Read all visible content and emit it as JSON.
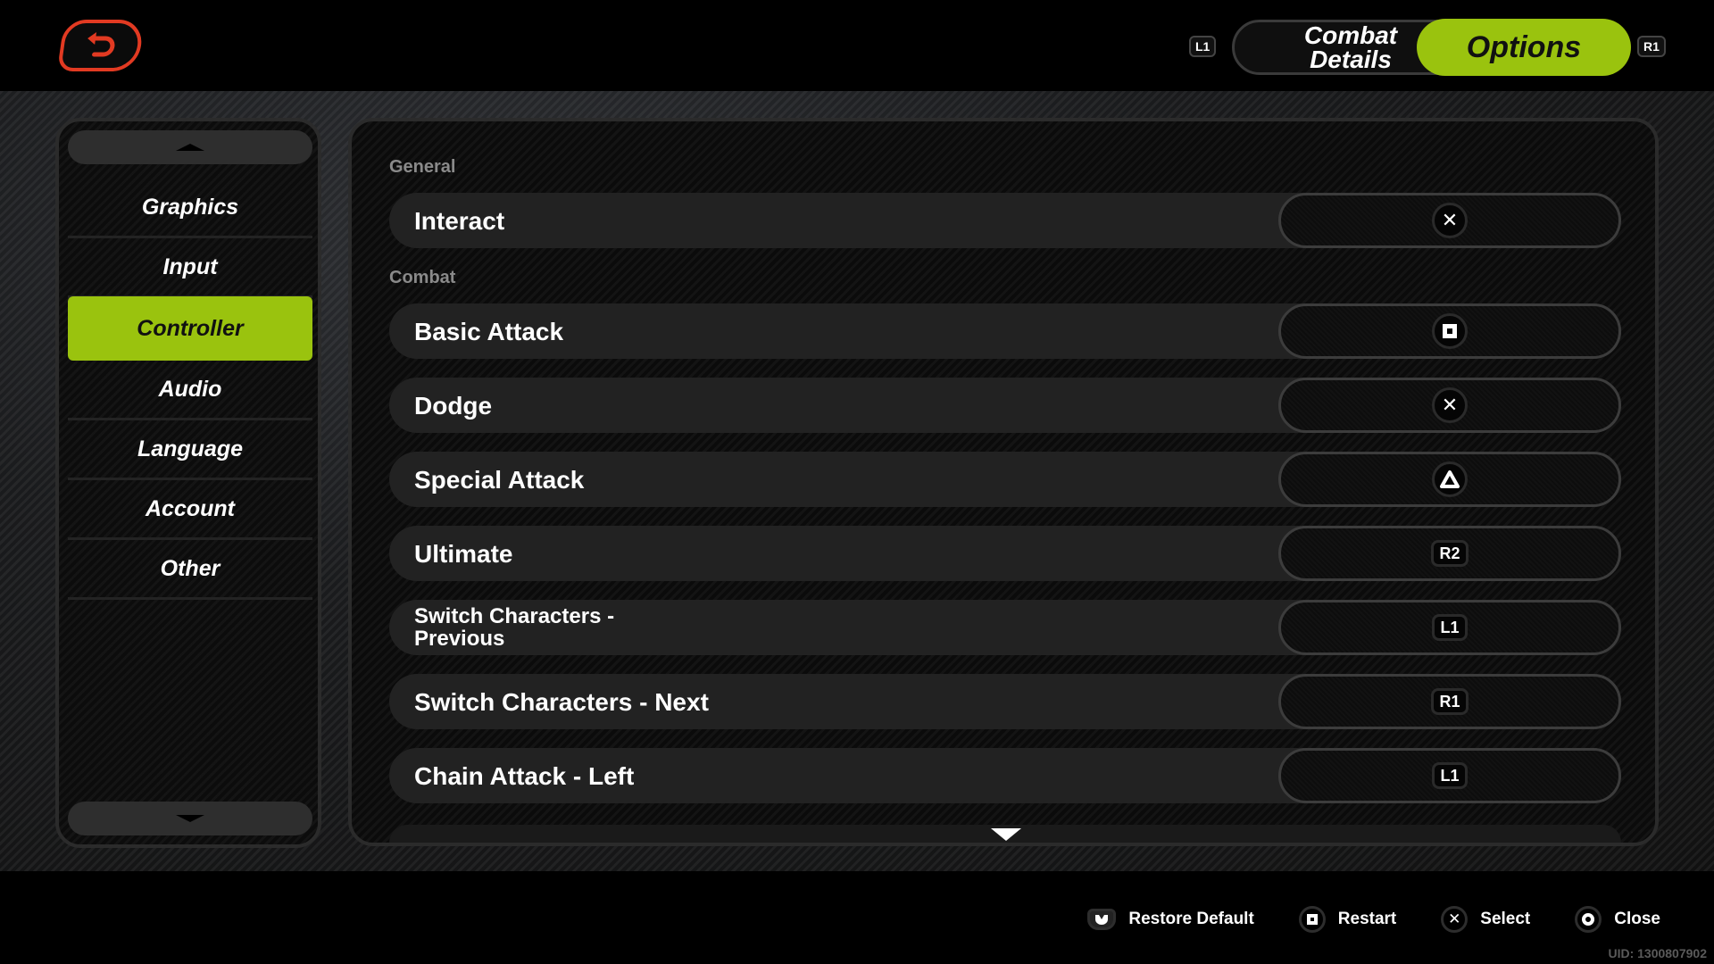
{
  "header": {
    "back_icon": "back-arrow-icon",
    "left_bumper": "L1",
    "right_bumper": "R1",
    "tabs": [
      {
        "label": "Combat\nDetails",
        "active": false
      },
      {
        "label": "Options",
        "active": true
      }
    ]
  },
  "sidebar": {
    "items": [
      {
        "label": "Graphics",
        "active": false
      },
      {
        "label": "Input",
        "active": false
      },
      {
        "label": "Controller",
        "active": true
      },
      {
        "label": "Audio",
        "active": false
      },
      {
        "label": "Language",
        "active": false
      },
      {
        "label": "Account",
        "active": false
      },
      {
        "label": "Other",
        "active": false
      }
    ]
  },
  "main": {
    "sections": [
      {
        "title": "General",
        "rows": [
          {
            "label": "Interact",
            "binding": "cross"
          }
        ]
      },
      {
        "title": "Combat",
        "rows": [
          {
            "label": "Basic Attack",
            "binding": "square"
          },
          {
            "label": "Dodge",
            "binding": "cross"
          },
          {
            "label": "Special Attack",
            "binding": "triangle"
          },
          {
            "label": "Ultimate",
            "binding": "R2"
          },
          {
            "label": "Switch Characters - Previous",
            "binding": "L1"
          },
          {
            "label": "Switch Characters - Next",
            "binding": "R1"
          },
          {
            "label": "Chain Attack - Left",
            "binding": "L1"
          }
        ]
      }
    ]
  },
  "footer": {
    "hints": [
      {
        "icon": "touchpad-icon",
        "label": "Restore Default"
      },
      {
        "icon": "square-icon",
        "label": "Restart"
      },
      {
        "icon": "cross-icon",
        "label": "Select"
      },
      {
        "icon": "circle-icon",
        "label": "Close"
      }
    ],
    "uid": "UID: 1300807902"
  },
  "colors": {
    "accent": "#9ac30e",
    "back_button": "#e23a22"
  }
}
